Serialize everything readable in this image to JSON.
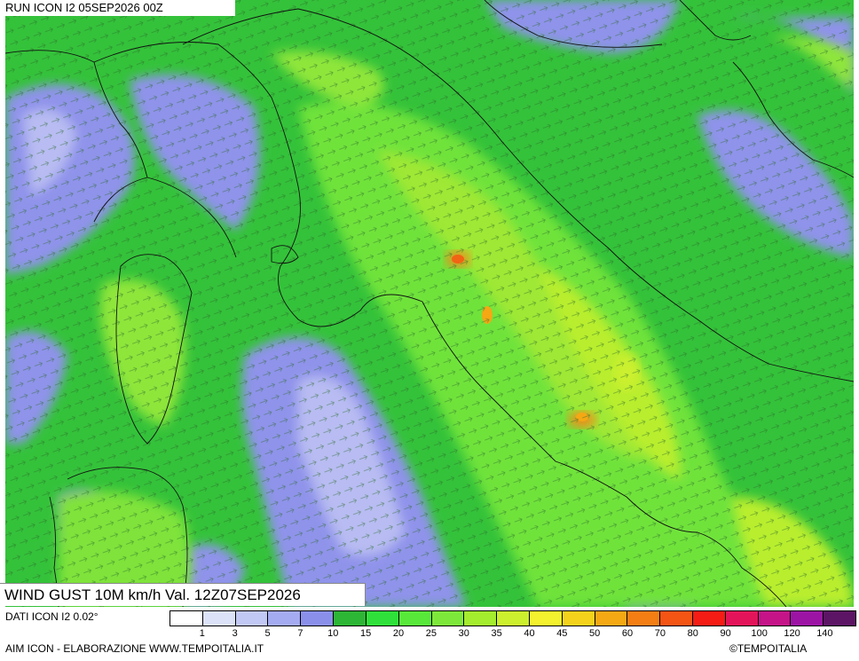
{
  "header": {
    "run_label": "RUN ICON I2 05SEP2026 00Z"
  },
  "footer": {
    "title": "WIND GUST 10M km/h Val. 12Z07SEP2026",
    "data_source": "DATI ICON I2 0.02°",
    "credit_left": "AIM ICON - ELABORAZIONE WWW.TEMPOITALIA.IT",
    "credit_right": "©TEMPOITALIA"
  },
  "legend": {
    "colors": [
      "#ffffff",
      "#dce2f8",
      "#c2c8f4",
      "#a4abf0",
      "#8a90ea",
      "#2db536",
      "#2fe03a",
      "#58e83a",
      "#7ee83a",
      "#a4ec2e",
      "#ccf02e",
      "#f4f22e",
      "#f4d21c",
      "#f4a814",
      "#f47e14",
      "#f45414",
      "#f41c14",
      "#e4145a",
      "#c41488",
      "#9c14a4",
      "#5c1464"
    ],
    "ticks": [
      "1",
      "3",
      "5",
      "7",
      "10",
      "15",
      "20",
      "25",
      "30",
      "35",
      "40",
      "45",
      "50",
      "60",
      "70",
      "80",
      "90",
      "100",
      "120",
      "140"
    ]
  },
  "map": {
    "colors": {
      "sea_calm": "#8f93ea",
      "sea_light": "#b8bcf2",
      "wind_moderate": "#34c23a",
      "wind_fresh": "#6fe33a",
      "wind_strong": "#b9ee2e",
      "gust_peak": "#f08a1a"
    }
  }
}
